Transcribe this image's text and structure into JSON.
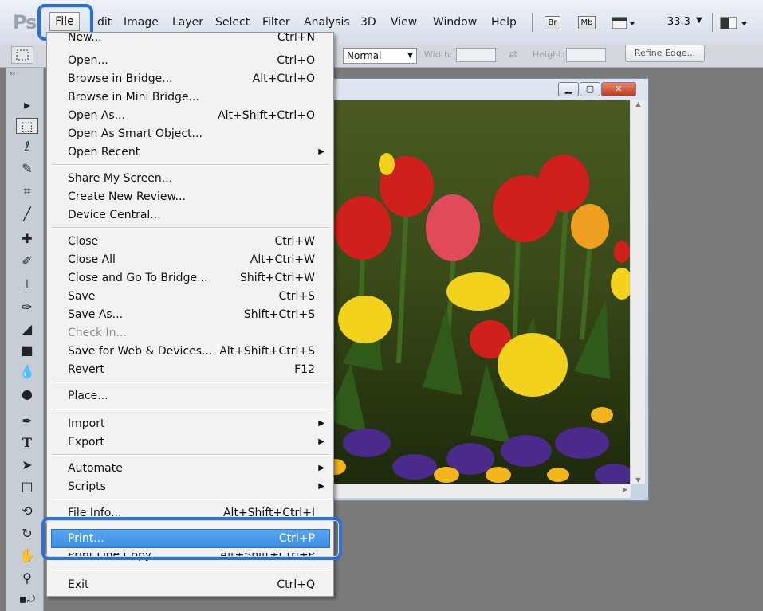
{
  "app": {
    "logo": "Ps",
    "zoom": "33.3"
  },
  "menubar": {
    "file": "File",
    "edit": "dit",
    "image": "Image",
    "layer": "Layer",
    "select": "Select",
    "filter": "Filter",
    "analysis": "Analysis",
    "threed": "3D",
    "view": "View",
    "window": "Window",
    "help": "Help",
    "bridge_badge": "Br",
    "minibridge_badge": "Mb"
  },
  "options": {
    "style_value": "Normal",
    "width_label": "Width:",
    "height_label": "Height:",
    "refine_label": "Refine Edge..."
  },
  "file_menu": {
    "new": "New...",
    "new_sc": "Ctrl+N",
    "open": "Open...",
    "open_sc": "Ctrl+O",
    "browse_bridge": "Browse in Bridge...",
    "browse_bridge_sc": "Alt+Ctrl+O",
    "browse_mini": "Browse in Mini Bridge...",
    "open_as": "Open As...",
    "open_as_sc": "Alt+Shift+Ctrl+O",
    "open_smart": "Open As Smart Object...",
    "open_recent": "Open Recent",
    "share_screen": "Share My Screen...",
    "create_review": "Create New Review...",
    "device_central": "Device Central...",
    "close": "Close",
    "close_sc": "Ctrl+W",
    "close_all": "Close All",
    "close_all_sc": "Alt+Ctrl+W",
    "close_bridge": "Close and Go To Bridge...",
    "close_bridge_sc": "Shift+Ctrl+W",
    "save": "Save",
    "save_sc": "Ctrl+S",
    "save_as": "Save As...",
    "save_as_sc": "Shift+Ctrl+S",
    "check_in": "Check In...",
    "save_web": "Save for Web & Devices...",
    "save_web_sc": "Alt+Shift+Ctrl+S",
    "revert": "Revert",
    "revert_sc": "F12",
    "place": "Place...",
    "import": "Import",
    "export": "Export",
    "automate": "Automate",
    "scripts": "Scripts",
    "file_info": "File Info...",
    "file_info_sc": "Alt+Shift+Ctrl+I",
    "print": "Print...",
    "print_sc": "Ctrl+P",
    "print_one": "Print One Copy",
    "print_one_sc": "Alt+Shift+Ctrl+P",
    "exit": "Exit",
    "exit_sc": "Ctrl+Q"
  },
  "colors": {
    "highlight": "#3c8fe3",
    "callout": "#2e6fd6"
  }
}
